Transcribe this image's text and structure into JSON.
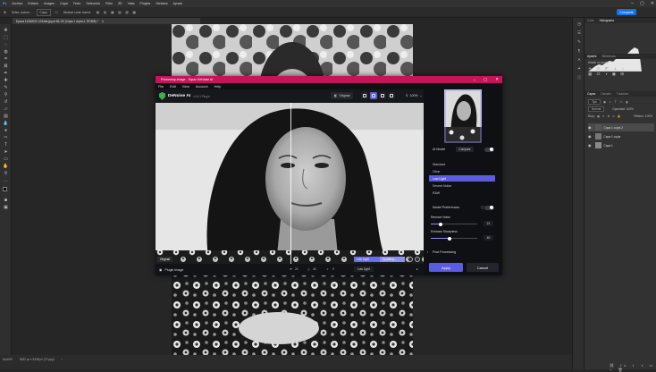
{
  "ps": {
    "menu": [
      "Archivo",
      "Edición",
      "Imagen",
      "Capa",
      "Texto",
      "Selección",
      "Filtro",
      "3D",
      "Vista",
      "Plugins",
      "Ventana",
      "Ayuda"
    ],
    "options": {
      "tool": "Selec. autom.:",
      "layer": "Capa",
      "transform": "Mostrar contr. transf."
    },
    "share_label": "Compartir",
    "doc_tab": "Epoca 11062022 1234ab.jpg al 66,1% (Capa 1 copia 2, RGB/8) *",
    "status": {
      "zoom": "66,66%",
      "size": "3632 px x 5448 px (72 ppp)"
    },
    "histogram_tabs": [
      "Color",
      "Histograma"
    ],
    "adjust_tabs": [
      "Ajustes",
      "Bibliotecas"
    ],
    "adjust_label": "Añadir un ajuste",
    "layer_tabs": [
      "Capas",
      "Canales",
      "Trazados"
    ],
    "layer_filter": "Tipo",
    "blend_mode": "Normal",
    "opacity": "Opacidad: 100%",
    "lock_label": "Bloq.:",
    "fill": "Relleno: 100%",
    "layers": [
      {
        "name": "Capa 1 copia 2",
        "selected": true
      },
      {
        "name": "Capa 1 copia",
        "selected": false
      },
      {
        "name": "Capa 1",
        "selected": false
      }
    ]
  },
  "topaz": {
    "title": "Photoshop-image - Topaz DeNoise AI",
    "menu": [
      "File",
      "Edit",
      "View",
      "Account",
      "Help"
    ],
    "app_name": "DeNoise AI",
    "version": "v3.6.3 Plugin",
    "original_btn": "Original",
    "zoom": "100%",
    "label_original": "Original",
    "label_lowlight": "Low Light",
    "label_updating": "Updating...",
    "bottom_title": "Plugin Image",
    "stats": {
      "noise": "21",
      "sharp": "40",
      "extra": "0"
    },
    "lowlight_chip": "Low Light",
    "side": {
      "ai_model": "AI Model",
      "compare": "Compare",
      "models": [
        "Standard",
        "Clear",
        "Low Light",
        "Severe Noise",
        "RAW"
      ],
      "selected_model": "Low Light",
      "model_prefs": "Model Preferences",
      "remove_noise": "Remove Noise",
      "remove_noise_value": "21",
      "enhance_sharpness": "Enhance Sharpness",
      "enhance_sharpness_value": "40",
      "post_processing": "Post Processing",
      "apply": "Apply",
      "cancel": "Cancel"
    }
  }
}
